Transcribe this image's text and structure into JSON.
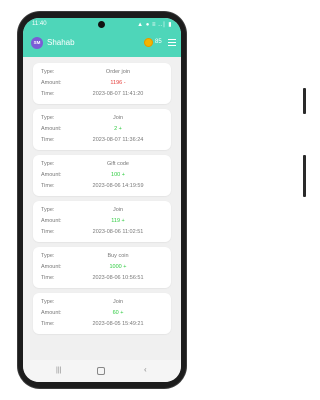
{
  "status": {
    "time": "11:40",
    "icons": "▲ ● ≡ ..∣ ▮"
  },
  "appbar": {
    "avatar_initials": "SM",
    "username": "Shahab",
    "coins": "85"
  },
  "labels": {
    "type": "Type:",
    "amount": "Amount:",
    "time": "Time:"
  },
  "transactions": [
    {
      "type": "Order join",
      "amount": "1196 -",
      "time": "2023-08-07 11:41:20",
      "direction": "debit"
    },
    {
      "type": "Join",
      "amount": "2 +",
      "time": "2023-08-07 11:36:24",
      "direction": "credit"
    },
    {
      "type": "Gift code",
      "amount": "100 +",
      "time": "2023-08-06 14:19:59",
      "direction": "credit"
    },
    {
      "type": "Join",
      "amount": "119 +",
      "time": "2023-08-06 11:02:51",
      "direction": "credit"
    },
    {
      "type": "Buy coin",
      "amount": "1000 +",
      "time": "2023-08-06 10:56:51",
      "direction": "credit"
    },
    {
      "type": "Join",
      "amount": "60 +",
      "time": "2023-08-05 15:49:21",
      "direction": "credit"
    }
  ],
  "colors": {
    "header": "#4ed6b9",
    "debit": "#e53935",
    "credit": "#2ecc40",
    "coin": "#f4b400"
  },
  "navbar": {
    "recent_icon": "|||",
    "back_icon": "‹"
  }
}
